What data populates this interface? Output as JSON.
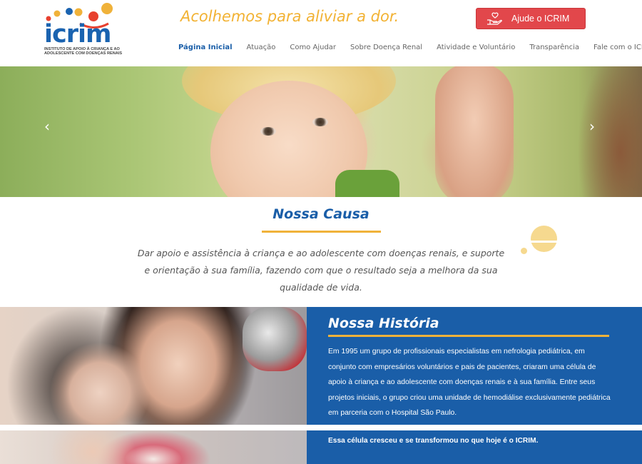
{
  "header": {
    "logo": {
      "word": "icrim",
      "subtitle": "INSTITUTO DE APOIO À CRIANÇA E AO ADOLESCENTE COM DOENÇAS RENAIS"
    },
    "tagline": "Acolhemos para aliviar a dor.",
    "donate_button": {
      "label": "Ajude o ICRIM",
      "icon": "hand-heart-icon"
    },
    "nav": [
      {
        "label": "Página Inicial",
        "active": true
      },
      {
        "label": "Atuação",
        "active": false
      },
      {
        "label": "Como Ajudar",
        "active": false
      },
      {
        "label": "Sobre Doença Renal",
        "active": false
      },
      {
        "label": "Atividade e Voluntário",
        "active": false
      },
      {
        "label": "Transparência",
        "active": false
      },
      {
        "label": "Fale com o ICRIM",
        "active": false
      }
    ]
  },
  "hero": {
    "prev_arrow": "‹",
    "next_arrow": "›"
  },
  "causa": {
    "title": "Nossa Causa",
    "text": "Dar apoio e assistência à criança e ao adolescente com doenças renais, e suporte e orientação à sua família, fazendo com que o resultado seja a melhora da sua qualidade de vida."
  },
  "historia": {
    "title": "Nossa História",
    "text": "Em 1995 um grupo de profissionais especialistas em nefrologia pediátrica, em conjunto com empresários voluntários e pais de pacientes, criaram uma célula de apoio à criança e ao adolescente com doenças renais e à sua família. Entre seus projetos iniciais, o grupo criou uma unidade de hemodiálise exclusivamente pediátrica em parceria com o Hospital São Paulo.",
    "next_text": "Essa célula cresceu e se transformou no que hoje é o ICRIM."
  },
  "colors": {
    "brand_blue": "#1a5ea8",
    "accent_yellow": "#f0b23a",
    "donate_red": "#e2474b"
  }
}
